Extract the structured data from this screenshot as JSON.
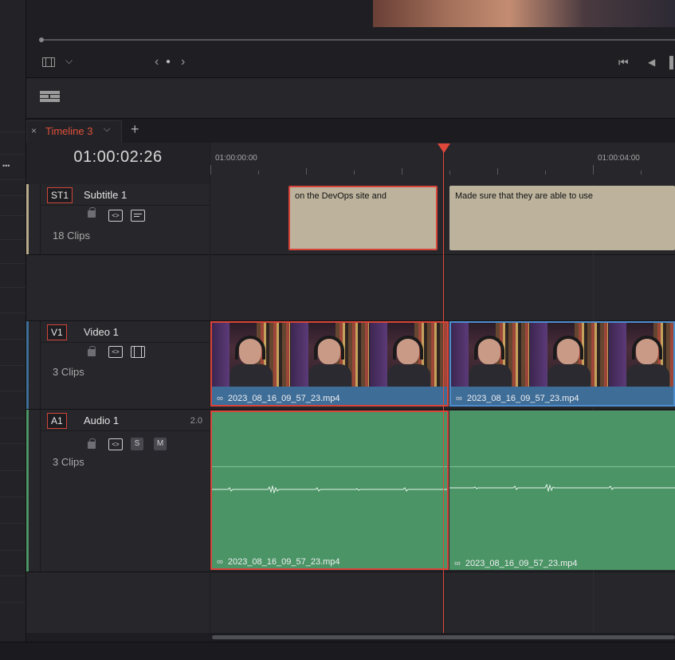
{
  "timeline": {
    "tab_label": "Timeline 3",
    "timecode": "01:00:02:26",
    "ruler": [
      "01:00:00:00",
      "01:00:04:00"
    ]
  },
  "tracks": {
    "subtitle": {
      "id": "ST1",
      "name": "Subtitle 1",
      "clips": "18 Clips",
      "color": "#b8ab8b"
    },
    "video": {
      "id": "V1",
      "name": "Video 1",
      "clips": "3 Clips",
      "color": "#3e6d98"
    },
    "audio": {
      "id": "A1",
      "name": "Audio 1",
      "clips": "3 Clips",
      "level": "2.0",
      "color": "#4a9466",
      "solo_label": "S",
      "mute_label": "M"
    }
  },
  "clips": {
    "subtitle": [
      "on the DevOps site and",
      "Made sure that they are able to use"
    ],
    "video": [
      "2023_08_16_09_57_23.mp4",
      "2023_08_16_09_57_23.mp4"
    ],
    "audio": [
      "2023_08_16_09_57_23.mp4",
      "2023_08_16_09_57_23.mp4"
    ]
  },
  "icons": {
    "tab_close": "×",
    "tab_chevron": "⌵",
    "tab_add": "+",
    "more": "•••",
    "nav_prev": "‹",
    "nav_dot": "●",
    "nav_next": "›",
    "go_start": "⏮",
    "play_reverse": "◀",
    "stop": "▌",
    "link": "🔗",
    "lock": "🔒",
    "auto_select": "<>",
    "caption": "▭",
    "film": "▦",
    "view_menu": "⌵"
  },
  "colors": {
    "accent": "#e0473b",
    "selection": "#d8443a"
  }
}
